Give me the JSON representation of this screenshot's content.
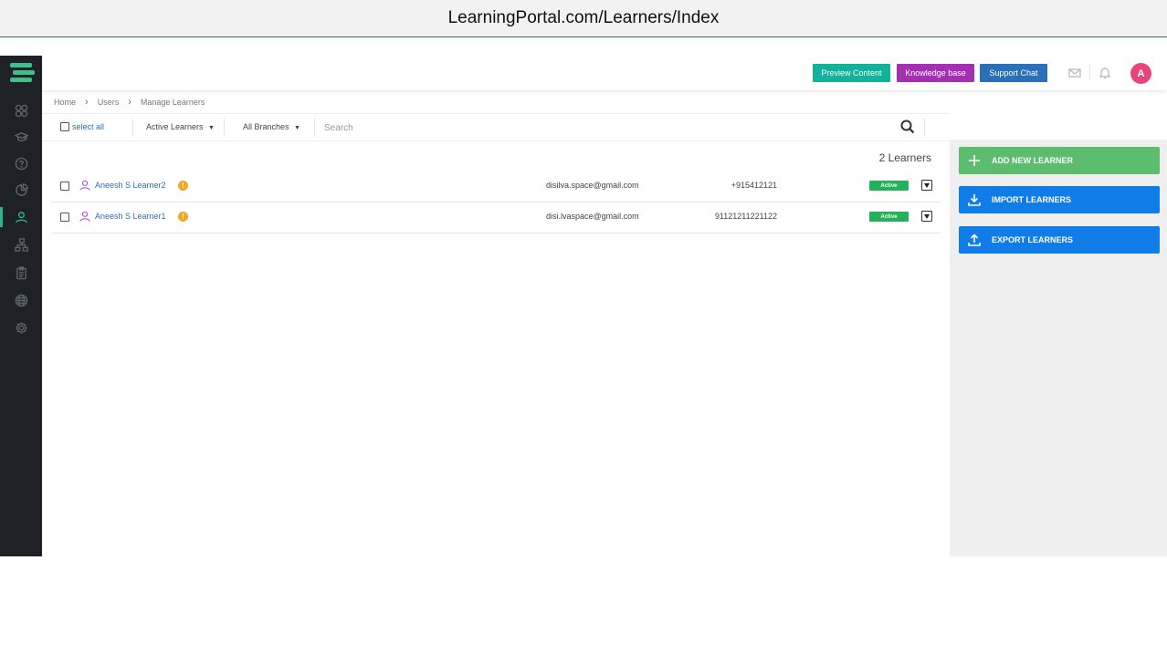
{
  "browser": {
    "url": "LearningPortal.com/Learners/Index"
  },
  "header": {
    "preview_label": "Preview Content",
    "knowledge_label": "Knowledge base",
    "support_label": "Support Chat",
    "avatar_initial": "A",
    "colors": {
      "preview": "#13b29a",
      "knowledge": "#a62eb5",
      "support": "#2a6fb7",
      "avatar": "#e8457c"
    }
  },
  "sidebar": {
    "icons": [
      "dashboard-icon",
      "courses-icon",
      "help-icon",
      "reports-icon",
      "learners-icon",
      "hierarchy-icon",
      "clipboard-icon",
      "globe-icon",
      "settings-icon"
    ],
    "active": "learners-icon"
  },
  "breadcrumb": [
    "Home",
    "Users",
    "Manage Learners"
  ],
  "filters": {
    "select_all": "select all",
    "learner_filter": "Active Learners",
    "branch_filter": "All Branches",
    "search_placeholder": "Search"
  },
  "count_label": "2 Learners",
  "learners": [
    {
      "name": "Aneesh S Learner2",
      "email": "disilva.space@gmail.com",
      "phone": "+915412121",
      "status": "Active"
    },
    {
      "name": "Aneesh S Learner1",
      "email": "disi.lvaspace@gmail.com",
      "phone": "91121211221122",
      "status": "Active"
    }
  ],
  "actions": {
    "add": "ADD NEW LEARNER",
    "import": "IMPORT LEARNERS",
    "export": "EXPORT LEARNERS",
    "colors": {
      "add": "#5cbd6e",
      "import": "#0f7ce8",
      "export": "#0f7ce8"
    }
  }
}
